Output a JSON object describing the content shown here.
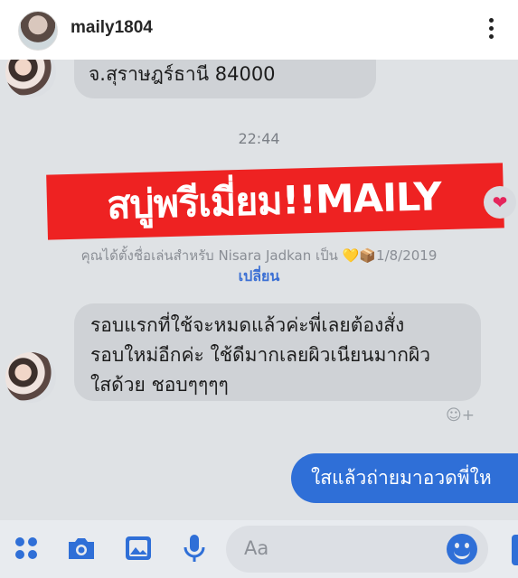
{
  "header": {
    "username": "maily1804"
  },
  "messages": {
    "top_address": "จ.สุราษฎร์ธานี 84000",
    "time": "22:44",
    "banner": "สบู่พรีเมี่ยม!!MAILY",
    "heart": "❤",
    "nickname_notice": "คุณได้ตั้งชื่อเล่นสำหรับ Nisara Jadkan เป็น 💛📦1/8/2019",
    "change_link": "เปลี่ยน",
    "incoming_lines": [
      "รอบแรกที่ใช้จะหมดแล้วค่ะพี่เลยต้องสั่ง",
      "รอบใหม่อีกค่ะ ใช้ดีมากเลยผิวเนียนมากผิว",
      "ใสด้วย ชอบๆๆๆๆ"
    ],
    "reaction_icon": "☺+",
    "outgoing": "ใสแล้วถ่ายมาอวดพี่ให"
  },
  "composer": {
    "placeholder": "Aa"
  },
  "icons": [
    "more-vertical-icon",
    "apps-icon",
    "camera-icon",
    "gallery-icon",
    "microphone-icon",
    "emoji-icon"
  ],
  "colors": {
    "accent": "#2f6fd7",
    "banner": "#ee2222",
    "chat_bg": "#dfe2e5",
    "bubble_in": "#cfd2d6"
  }
}
